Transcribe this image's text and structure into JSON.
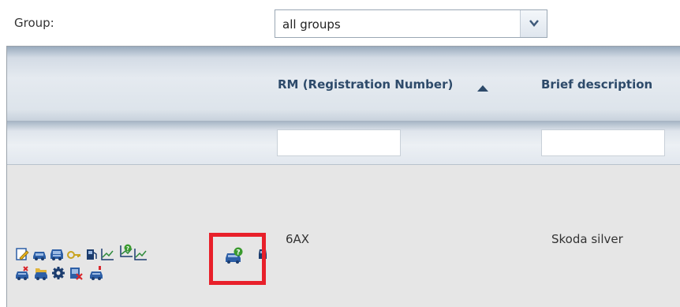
{
  "filter": {
    "label": "Group:",
    "selected": "all groups"
  },
  "grid": {
    "columns": {
      "rm": "RM (Registration Number)",
      "description": "Brief description"
    },
    "rows": [
      {
        "rm": "6AX",
        "description": "Skoda silver"
      }
    ]
  },
  "icons": {
    "row1": [
      "edit-note-icon",
      "car-icon",
      "car-details-icon",
      "key-icon",
      "fuel-icon",
      "chart-icon",
      "chart-help-icon",
      "car-help-icon",
      "car-more-icon"
    ],
    "row2": [
      "car-delete-icon",
      "car-folder-icon",
      "gear-icon",
      "document-delete-icon",
      "car-alert-icon"
    ]
  },
  "colors": {
    "highlight": "#e8202a",
    "header_text": "#2d4a6a",
    "car_blue": "#2d5fa6"
  }
}
